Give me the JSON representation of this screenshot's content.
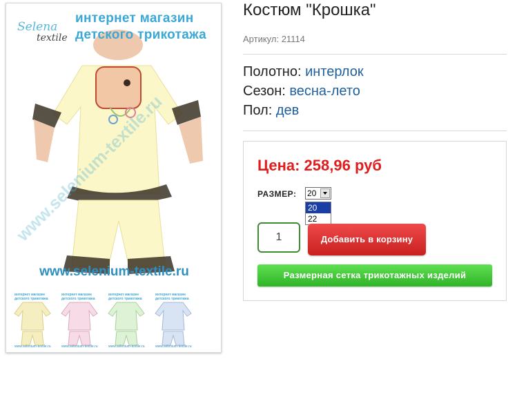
{
  "gallery": {
    "banner_line1": "интернет магазин",
    "banner_line2": "детского трикотажа",
    "logo_part1": "Selena",
    "logo_part2": "textile",
    "watermark": "www.selenium-textile.ru",
    "site_url": "www.selenium-textile.ru",
    "thumbnails": [
      {
        "color": "#f4eec0",
        "text1": "интернет магазин",
        "text2": "детского трикотажа",
        "url": "www.selenium-textile.ru"
      },
      {
        "color": "#f7dce8",
        "text1": "интернет магазин",
        "text2": "детского трикотажа",
        "url": "www.selenium-textile.ru"
      },
      {
        "color": "#def2d6",
        "text1": "интернет магазин",
        "text2": "детского трикотажа",
        "url": "www.selenium-textile.ru"
      },
      {
        "color": "#d8e4f4",
        "text1": "интернет магазин",
        "text2": "детского трикотажа",
        "url": "www.selenium-textile.ru"
      }
    ]
  },
  "product": {
    "title": "Костюм \"Крошка\"",
    "sku": "Артикул: 21114",
    "props": [
      {
        "label": "Полотно:",
        "value": "интерлок"
      },
      {
        "label": "Сезон:",
        "value": "весна-лето"
      },
      {
        "label": "Пол:",
        "value": "дев"
      }
    ]
  },
  "buy": {
    "price": "Цена: 258,96 руб",
    "size_label": "РАЗМЕР:",
    "size_selected": "20",
    "size_options": [
      "20",
      "22"
    ],
    "quantity": "1",
    "add_to_cart": "Добавить в корзину",
    "size_chart": "Размерная сетка трикотажных изделий"
  },
  "colors": {
    "price": "#e01d1d",
    "prop_value": "#1f5f9a",
    "cart_button": "#d42a2a",
    "size_chart_button": "#3fc634",
    "qty_border": "#3d8c2f"
  }
}
